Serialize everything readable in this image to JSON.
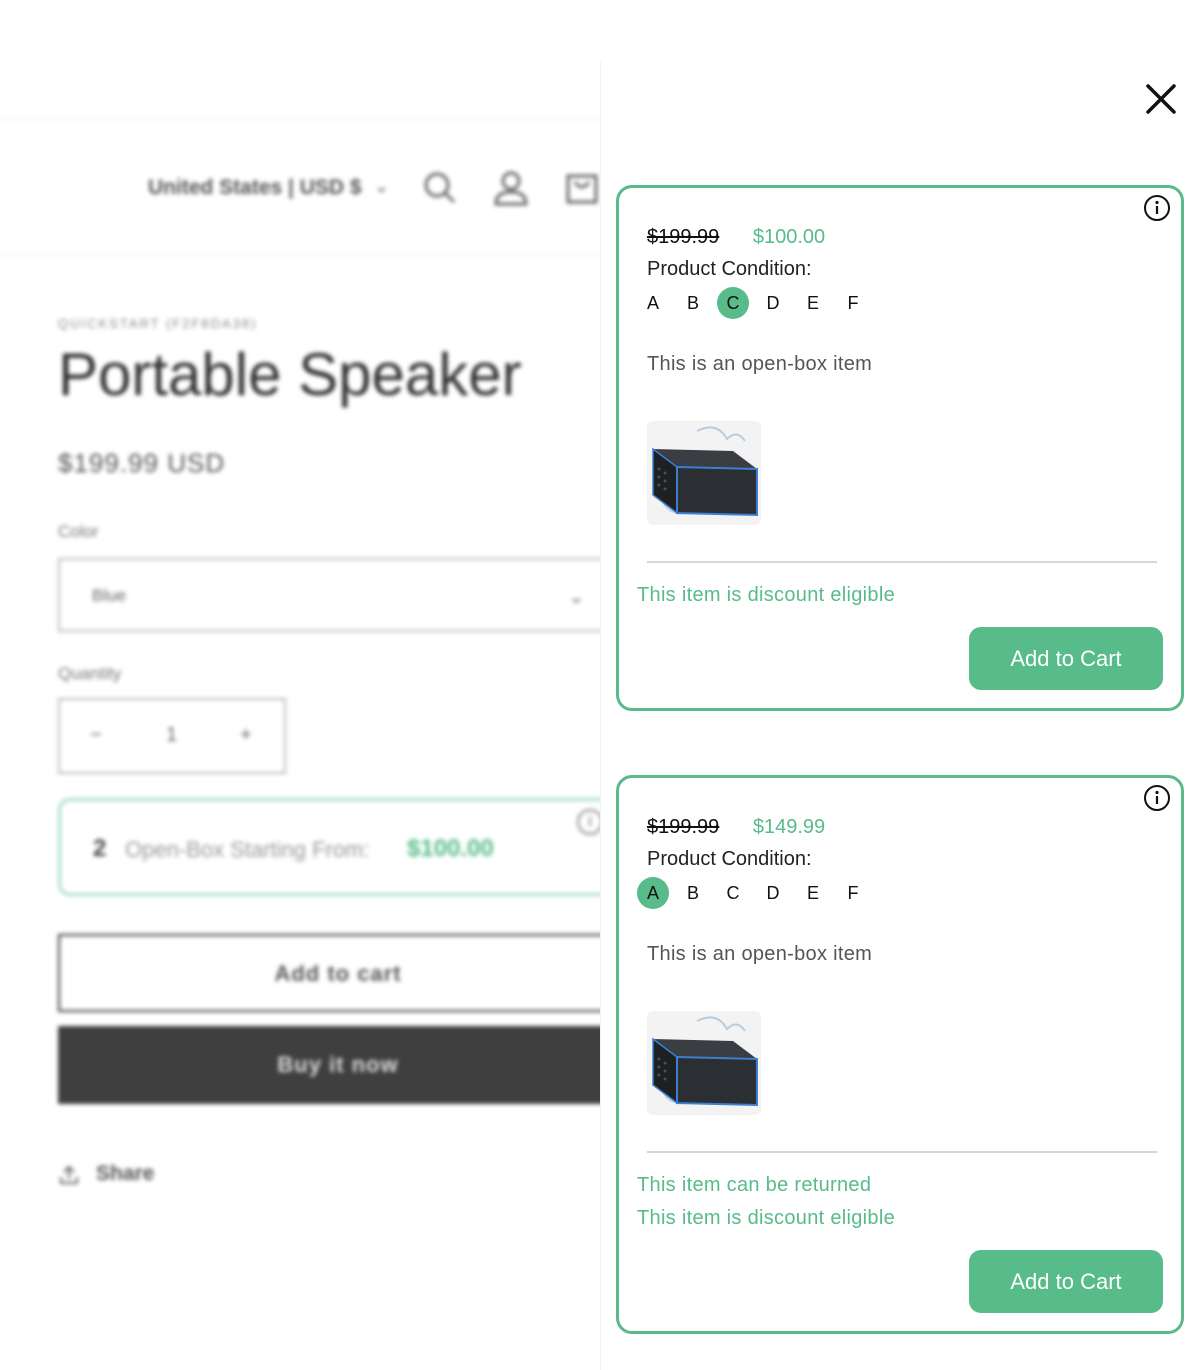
{
  "store": {
    "locale": "United States | USD $",
    "vendor": "QUICKSTART (F2F8DA38)",
    "product_title": "Portable Speaker",
    "price": "$199.99 USD",
    "color_label": "Color",
    "color_value": "Blue",
    "quantity_label": "Quantity",
    "quantity_minus": "−",
    "quantity_value": "1",
    "quantity_plus": "+",
    "open_box": {
      "count": "2",
      "label": "Open-Box Starting From:",
      "price": "$100.00"
    },
    "add_to_cart": "Add to cart",
    "buy_now": "Buy it now",
    "share": "Share"
  },
  "drawer": {
    "close_icon": "close-icon",
    "listings": [
      {
        "original_price": "$199.99",
        "sale_price": "$100.00",
        "condition_label": "Product Condition:",
        "grades": [
          "A",
          "B",
          "C",
          "D",
          "E",
          "F"
        ],
        "selected_grade": "C",
        "description": "This is an open-box item",
        "perks": [
          "This item is discount eligible"
        ],
        "button": "Add to Cart"
      },
      {
        "original_price": "$199.99",
        "sale_price": "$149.99",
        "condition_label": "Product Condition:",
        "grades": [
          "A",
          "B",
          "C",
          "D",
          "E",
          "F"
        ],
        "selected_grade": "A",
        "description": "This is an open-box item",
        "perks": [
          "This item can be returned",
          "This item is discount eligible"
        ],
        "button": "Add to Cart"
      }
    ]
  },
  "colors": {
    "accent": "#57bb8a",
    "card_border": "#5bb98c"
  }
}
